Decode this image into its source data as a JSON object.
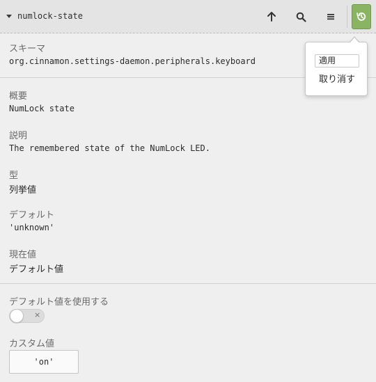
{
  "header": {
    "title": "numlock-state",
    "buttons": [
      {
        "name": "go-up",
        "icon": "arrow-up-icon"
      },
      {
        "name": "search",
        "icon": "search-icon"
      },
      {
        "name": "menu",
        "icon": "hamburger-menu-icon"
      },
      {
        "name": "history",
        "icon": "history-icon"
      }
    ],
    "accent_color": "#8ab363"
  },
  "schema": {
    "label": "スキーマ",
    "value": "org.cinnamon.settings-daemon.peripherals.keyboard"
  },
  "summary": {
    "label": "概要",
    "value": "NumLock state"
  },
  "description": {
    "label": "説明",
    "value": "The remembered state of the NumLock LED."
  },
  "type": {
    "label": "型",
    "value": "列挙値"
  },
  "default": {
    "label": "デフォルト",
    "value": "'unknown'"
  },
  "current": {
    "label": "現在値",
    "value": "デフォルト値"
  },
  "use_default": {
    "label": "デフォルト値を使用する",
    "toggle_on": false,
    "toggle_symbol": "×"
  },
  "custom": {
    "label": "カスタム値",
    "value": "'on'"
  },
  "popover": {
    "apply_label": "適用",
    "undo_label": "取り消す"
  }
}
